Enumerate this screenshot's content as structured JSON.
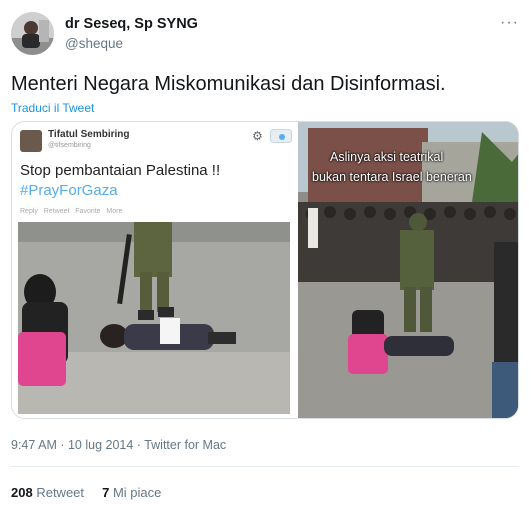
{
  "author": {
    "name": "dr Seseq, Sp SYNG",
    "handle": "@sheque"
  },
  "tweet": {
    "text": "Menteri Negara Miskomunikasi dan Disinformasi.",
    "translate_label": "Traduci il Tweet",
    "timestamp": "9:47 AM · 10 lug 2014 · Twitter for Mac"
  },
  "embedded_tweet": {
    "name": "Tifatul Sembiring",
    "handle": "@tifsembiring",
    "text": "Stop pembantaian Palestina !!",
    "hashtag": "#PrayForGaza",
    "actions": [
      "Reply",
      "Retweet",
      "Favorite",
      "More"
    ]
  },
  "overlay_caption": {
    "line1": "Aslinya aksi teatrikal",
    "line2": "bukan tentara Israel beneran"
  },
  "stats": {
    "retweets_count": "208",
    "retweets_label": "Retweet",
    "likes_count": "7",
    "likes_label": "Mi piace"
  },
  "icons": {
    "more": "more-dots-icon",
    "gear": "gear-icon",
    "follow": "follow-icon"
  },
  "colors": {
    "link": "#1b95e0",
    "hashtag": "#55acee",
    "secondary": "#657786",
    "overlay_text": "#ffffff"
  }
}
